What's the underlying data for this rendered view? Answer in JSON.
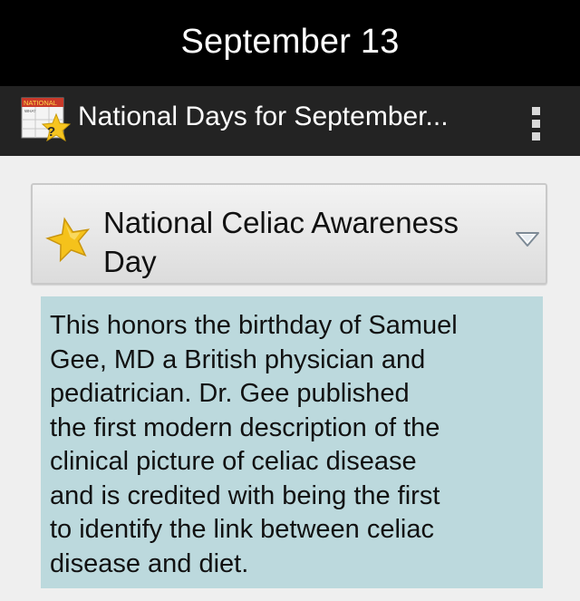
{
  "status": {
    "title": "September 13"
  },
  "action_bar": {
    "app_icon": "national-what-day-calendar-icon",
    "app_icon_label_top": "NATIONAL",
    "app_icon_label_small": "WHAT",
    "app_icon_question": "?",
    "title": "National Days for September...",
    "overflow_icon": "overflow-menu-icon"
  },
  "spinner": {
    "icon": "star-icon",
    "selected_label": "National Celiac Awareness Day",
    "arrow_icon": "dropdown-arrow-icon"
  },
  "description": {
    "text": "This honors the birthday of Samuel\nGee, MD a British physician and\npediatrician.  Dr. Gee published\nthe first modern description of the\nclinical picture of celiac disease\nand is credited with being the first\nto identify the link between celiac\ndisease and diet."
  },
  "colors": {
    "title_bar": "#000000",
    "action_bar": "#232323",
    "background": "#efefef",
    "description_panel": "#bcd9dd",
    "star": "#f5c21b"
  }
}
